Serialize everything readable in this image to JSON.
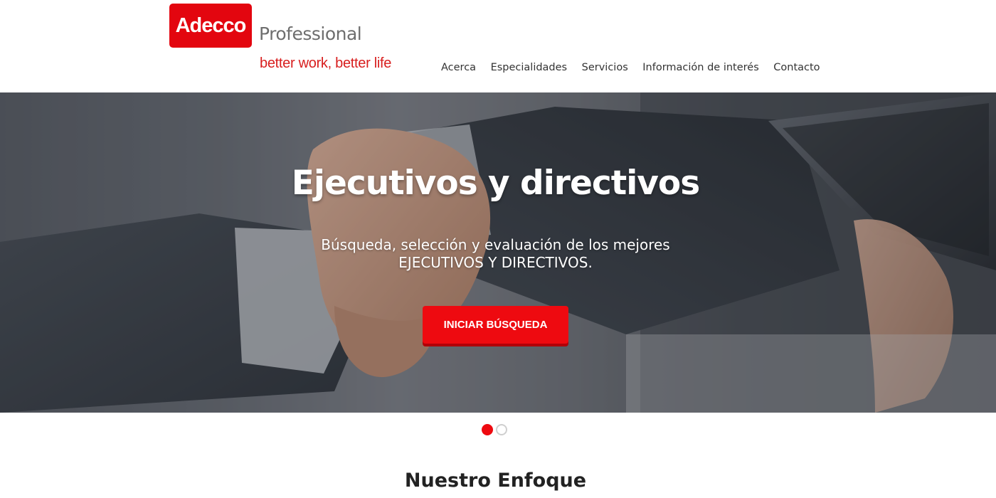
{
  "header": {
    "logo_text": "Adecco",
    "logo_suffix": "Professional",
    "tagline": "better work, better life",
    "brand_color": "#e3060f"
  },
  "nav": {
    "items": [
      {
        "label": "Acerca"
      },
      {
        "label": "Especialidades"
      },
      {
        "label": "Servicios"
      },
      {
        "label": "Información de interés"
      },
      {
        "label": "Contacto"
      }
    ]
  },
  "hero": {
    "title": "Ejecutivos y directivos",
    "subtitle_line1": "Búsqueda, selección y evaluación de los mejores",
    "subtitle_line2": "EJECUTIVOS Y DIRECTIVOS.",
    "button_label": "INICIAR BÚSQUEDA",
    "button_color": "#ee0a10"
  },
  "carousel": {
    "total_slides": 2,
    "active_slide": 1
  },
  "section": {
    "title": "Nuestro Enfoque"
  }
}
